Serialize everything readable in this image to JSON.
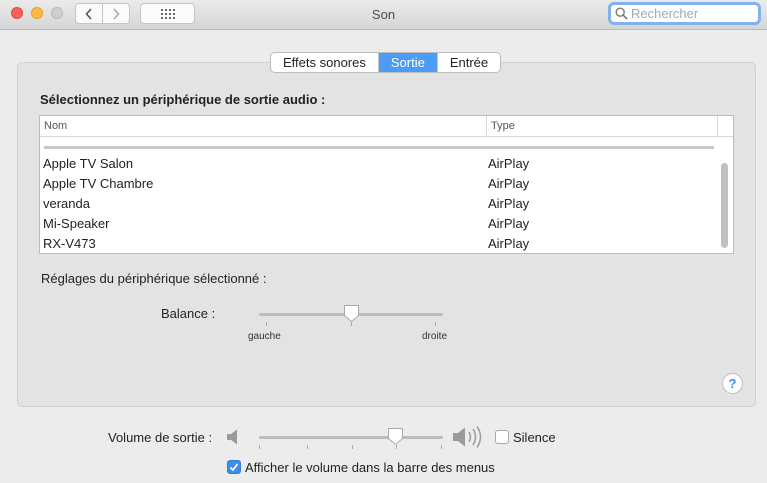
{
  "window": {
    "title": "Son"
  },
  "search": {
    "placeholder": "Rechercher",
    "value": ""
  },
  "tabs": [
    {
      "label": "Effets sonores",
      "active": false
    },
    {
      "label": "Sortie",
      "active": true
    },
    {
      "label": "Entrée",
      "active": false
    }
  ],
  "output": {
    "heading": "Sélectionnez un périphérique de sortie audio :",
    "columns": {
      "name": "Nom",
      "type": "Type"
    },
    "devices": [
      {
        "name": "Apple TV Salon",
        "type": "AirPlay"
      },
      {
        "name": "Apple TV Chambre",
        "type": "AirPlay"
      },
      {
        "name": "veranda",
        "type": "AirPlay"
      },
      {
        "name": "Mi-Speaker",
        "type": "AirPlay"
      },
      {
        "name": "RX-V473",
        "type": "AirPlay"
      }
    ]
  },
  "settings": {
    "label": "Réglages du périphérique sélectionné :",
    "balance_label": "Balance :",
    "balance_left": "gauche",
    "balance_right": "droite",
    "balance_value": 0.5
  },
  "volume": {
    "label": "Volume de sortie :",
    "value": 0.74,
    "mute_label": "Silence",
    "mute_checked": false,
    "show_in_menubar_label": "Afficher le volume dans la barre des menus",
    "show_in_menubar_checked": true
  },
  "help": {
    "label": "?"
  },
  "icons": {
    "back": "chevron-left-icon",
    "forward": "chevron-right-icon",
    "grid": "grid-icon",
    "search": "search-icon",
    "speaker_low": "speaker-low-icon",
    "speaker_high": "speaker-high-icon"
  },
  "colors": {
    "accent": "#4a9cf7",
    "checkbox": "#3a8ef0"
  }
}
